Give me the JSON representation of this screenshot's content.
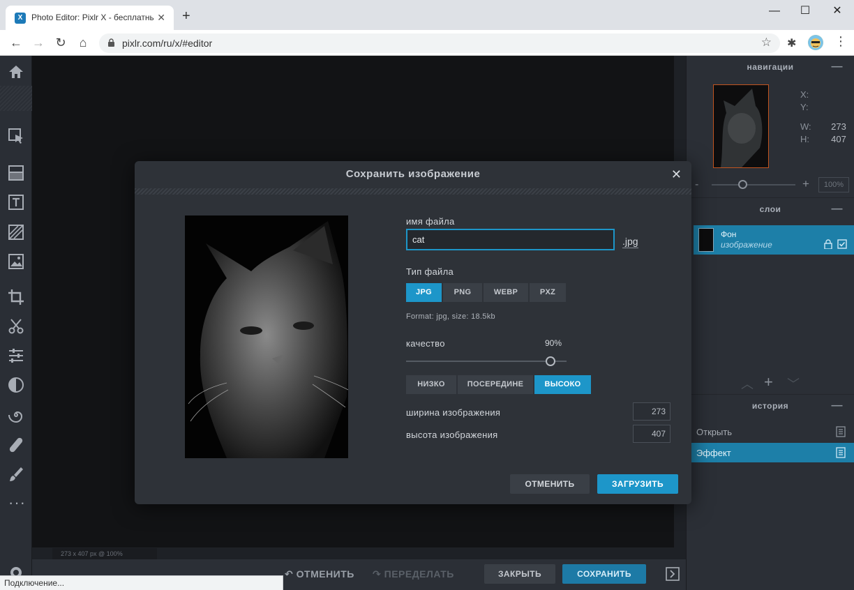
{
  "browser": {
    "tab_title": "Photo Editor: Pixlr X - бесплатный",
    "tab_favicon": "X",
    "url": "pixlr.com/ru/x/#editor",
    "status_text": "Подключение..."
  },
  "editor": {
    "canvas_info": "273 x 407 px @ 100%",
    "bottom": {
      "undo": "ОТМЕНИТЬ",
      "redo": "ПЕРЕДЕЛАТЬ",
      "close": "ЗАКРЫТЬ",
      "save": "СОХРАНИТЬ"
    },
    "navigator": {
      "title": "навигации",
      "x_label": "X:",
      "y_label": "Y:",
      "w_label": "W:",
      "w_value": "273",
      "h_label": "H:",
      "h_value": "407",
      "zoom": "100%",
      "zoom_minus": "-",
      "zoom_plus": "+"
    },
    "layers": {
      "title": "слои",
      "items": [
        {
          "name": "Фон",
          "type": "изображение"
        }
      ]
    },
    "history": {
      "title": "история",
      "items": [
        {
          "label": "Открыть",
          "active": false
        },
        {
          "label": "Эффект",
          "active": true
        }
      ]
    }
  },
  "dialog": {
    "title": "Сохранить изображение",
    "filename_label": "имя файла",
    "filename_value": "cat",
    "extension": ".jpg",
    "filetype_label": "Тип файла",
    "filetypes": [
      "JPG",
      "PNG",
      "WEBP",
      "PXZ"
    ],
    "filetype_selected": "JPG",
    "format_info": "Format: jpg, size: 18.5kb",
    "quality_label": "качество",
    "quality_value": "90%",
    "quality_fraction": 0.9,
    "quality_presets": [
      "НИЗКО",
      "ПОСЕРЕДИНЕ",
      "ВЫСОКО"
    ],
    "quality_preset_selected": "ВЫСОКО",
    "width_label": "ширина изображения",
    "width_value": "273",
    "height_label": "высота изображения",
    "height_value": "407",
    "cancel": "ОТМЕНИТЬ",
    "download": "ЗАГРУЗИТЬ"
  },
  "colors": {
    "accent": "#1d96c9",
    "panel": "#2b2f36",
    "dialog": "#2e3238"
  }
}
